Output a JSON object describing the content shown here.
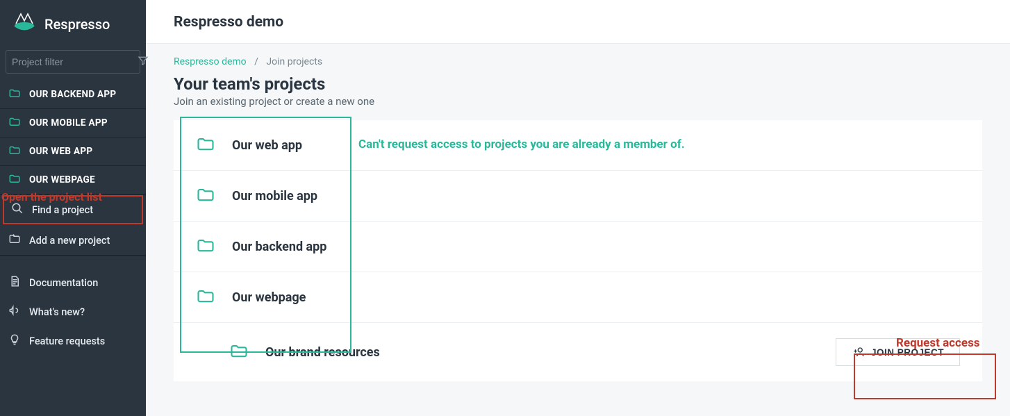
{
  "brand": "Respresso",
  "sidebar": {
    "filter_placeholder": "Project filter",
    "projects": [
      {
        "label": "OUR BACKEND APP"
      },
      {
        "label": "OUR MOBILE APP"
      },
      {
        "label": "OUR WEB APP"
      },
      {
        "label": "OUR WEBPAGE"
      }
    ],
    "find": "Find a project",
    "add": "Add a new project",
    "docs": "Documentation",
    "whatsnew": "What's new?",
    "feature": "Feature requests"
  },
  "header": {
    "title": "Respresso demo"
  },
  "breadcrumb": {
    "team": "Respresso demo",
    "sep": "/",
    "page": "Join projects"
  },
  "page": {
    "title": "Your team's projects",
    "subtitle": "Join an existing project or create a new one"
  },
  "projects": [
    {
      "name": "Our web app",
      "joinable": false
    },
    {
      "name": "Our mobile app",
      "joinable": false
    },
    {
      "name": "Our backend app",
      "joinable": false
    },
    {
      "name": "Our webpage",
      "joinable": false
    },
    {
      "name": "Our brand resources",
      "joinable": true
    }
  ],
  "join_label": "JOIN PROJECT",
  "annotations": {
    "open_list": "Open the project list",
    "already_member": "Can't request access to projects you are already a member of.",
    "request_access": "Request access"
  },
  "colors": {
    "accent": "#29b89a",
    "danger": "#c0392b",
    "sidebar_bg": "#2a3540"
  }
}
